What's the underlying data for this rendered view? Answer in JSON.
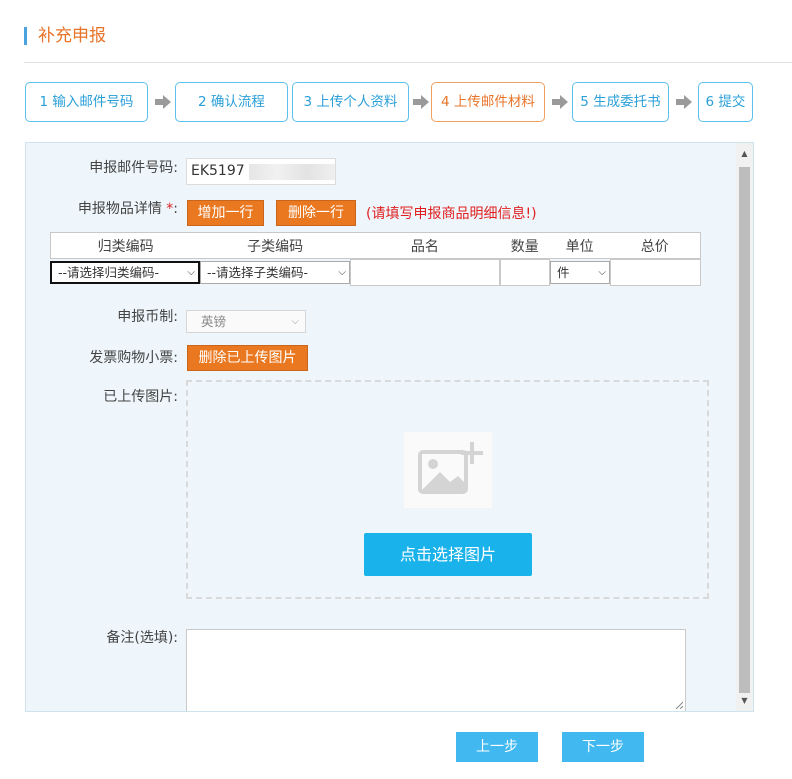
{
  "page": {
    "title": "补充申报"
  },
  "steps": [
    {
      "label": "1 输入邮件号码",
      "active": false
    },
    {
      "label": "2 确认流程",
      "active": false
    },
    {
      "label": "3 上传个人资料",
      "active": false
    },
    {
      "label": "4 上传邮件材料",
      "active": true
    },
    {
      "label": "5 生成委托书",
      "active": false
    },
    {
      "label": "6 提交",
      "active": false
    }
  ],
  "form": {
    "mail_no_label": "申报邮件号码:",
    "mail_no_value": "EK5197",
    "items_label": "申报物品详情",
    "required_mark": "*",
    "items_label_colon": ":",
    "add_row_label": "增加一行",
    "delete_row_label": "删除一行",
    "items_hint": "(请填写申报商品明细信息!)",
    "table_headers": [
      "归类编码",
      "子类编码",
      "品名",
      "数量",
      "单位",
      "总价"
    ],
    "row": {
      "category_select": "--请选择归类编码-",
      "subcategory_select": "--请选择子类编码-",
      "unit_select": "件"
    },
    "currency_label": "申报币制:",
    "currency_value": "英镑",
    "receipt_label": "发票购物小票:",
    "delete_uploaded_label": "删除已上传图片",
    "uploaded_label": "已上传图片:",
    "choose_image_label": "点击选择图片",
    "remark_label": "备注(选填):"
  },
  "nav": {
    "prev_label": "上一步",
    "next_label": "下一步"
  },
  "colors": {
    "accent_orange": "#e97820",
    "step_blue": "#5bc1ec",
    "primary_button": "#1ab2ea",
    "hint_red": "#e02020"
  }
}
